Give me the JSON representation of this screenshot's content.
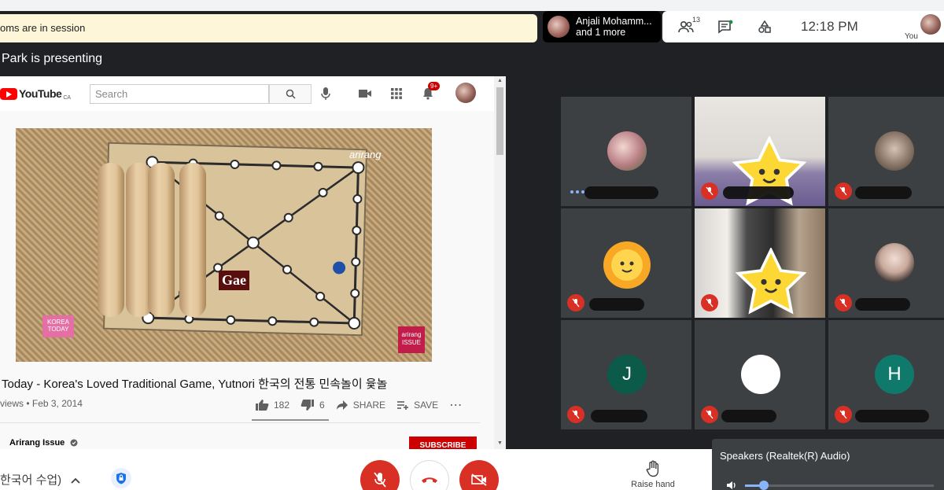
{
  "banner": {
    "text": "oms are in session"
  },
  "presenter_pill": {
    "line1": "Anjali Mohamm...",
    "line2": "and 1 more"
  },
  "topbar": {
    "people_count": "13",
    "time": "12:18  PM",
    "you_label": "You"
  },
  "presenting_label": "Park is presenting",
  "youtube": {
    "logo": "YouTube",
    "region": "CA",
    "search_placeholder": "Search",
    "notif_count": "9+",
    "video": {
      "overlay_gae": "Gae",
      "overlay_brand": "arirang",
      "badge_korea_today": "KOREA TODAY",
      "badge_issue": "arirang ISSUE"
    },
    "title": "Today - Korea's Loved Traditional Game, Yutnori 한국의 전통 민속놀이 윷놀",
    "meta": "views • Feb 3, 2014",
    "likes": "182",
    "dislikes": "6",
    "share_label": "SHARE",
    "save_label": "SAVE",
    "more_label": "⋯",
    "channel": "Arirang Issue",
    "subscribe_label": "SUBSCRIBE"
  },
  "grid": {
    "tiles": [
      {
        "type": "avatar-photo",
        "muted": false,
        "speaking": true
      },
      {
        "type": "camera-star",
        "muted": true
      },
      {
        "type": "avatar-photo",
        "muted": true
      },
      {
        "type": "sun-avatar",
        "muted": true
      },
      {
        "type": "camera-star",
        "muted": true
      },
      {
        "type": "avatar-photo",
        "muted": true
      },
      {
        "type": "initial",
        "initial": "J",
        "color": "#0b5a4a",
        "muted": true
      },
      {
        "type": "initial",
        "initial": "",
        "color": "#ffffff",
        "muted": true
      },
      {
        "type": "initial",
        "initial": "H",
        "color": "#0f7a6b",
        "muted": true
      }
    ]
  },
  "bottombar": {
    "meeting_name": "한국어 수업)",
    "raise_hand": "Raise hand"
  },
  "speakers": {
    "label": "Speakers (Realtek(R) Audio)",
    "volume": 0.1
  },
  "colors": {
    "accent_red": "#d93025",
    "yt_red": "#ff0000",
    "banner_bg": "#fdf6d8"
  }
}
